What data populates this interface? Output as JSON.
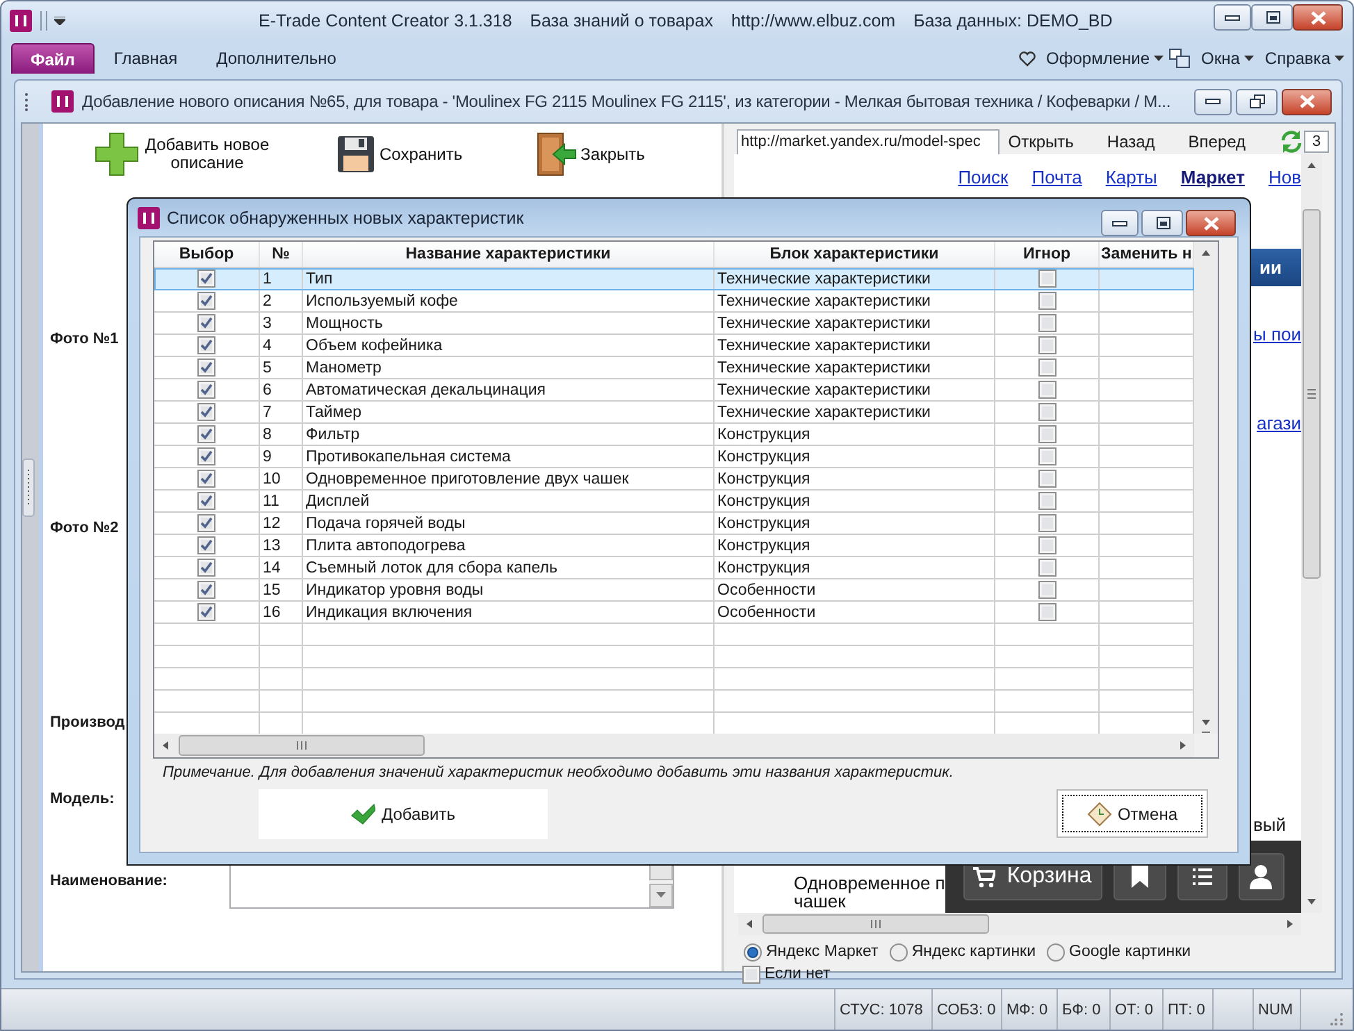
{
  "window": {
    "title_parts": [
      "E-Trade Content Creator 3.1.318",
      "База знаний о товарах",
      "http://www.elbuz.com",
      "База данных: DEMO_BD"
    ]
  },
  "ribbon": {
    "tabs": [
      {
        "label": "Файл",
        "selected": true
      },
      {
        "label": "Главная",
        "selected": false
      },
      {
        "label": "Дополнительно",
        "selected": false
      }
    ],
    "menus": [
      {
        "label": "Оформление",
        "kind": "theme"
      },
      {
        "label": "Окна",
        "kind": "windows"
      },
      {
        "label": "Справка",
        "kind": "help"
      }
    ]
  },
  "document": {
    "title": "Добавление нового описания №65, для товара - 'Moulinex FG 2115 Moulinex FG 2115', из категории - Мелкая бытовая техника / Кофеварки / М...",
    "toolbar": [
      {
        "label": "Добавить новое описание",
        "kind": "add"
      },
      {
        "label": "Сохранить",
        "kind": "save"
      },
      {
        "label": "Закрыть",
        "kind": "close"
      }
    ],
    "form": [
      {
        "label": "Фото №1",
        "kind": "label"
      },
      {
        "label": "Фото №2",
        "kind": "label"
      },
      {
        "label": "Производ",
        "kind": "label"
      },
      {
        "label": "Модель:",
        "kind": "label"
      },
      {
        "label": "Наименование:",
        "kind": "text"
      }
    ]
  },
  "browser": {
    "url": "http://market.yandex.ru/model-spec",
    "buttons": [
      "Открыть",
      "Назад",
      "Вперед"
    ],
    "tab_count": "3",
    "links": [
      {
        "label": "Поиск",
        "selected": false
      },
      {
        "label": "Почта",
        "selected": false
      },
      {
        "label": "Карты",
        "selected": false
      },
      {
        "label": "Маркет",
        "selected": true
      },
      {
        "label": "Нов",
        "selected": false
      }
    ],
    "page_texts": [
      {
        "text": "ии",
        "kind": "heading"
      },
      {
        "text": "ы пои",
        "kind": "link"
      },
      {
        "text": "агази",
        "kind": "link"
      },
      {
        "text": "вый",
        "kind": "text"
      }
    ],
    "product_lines": [
      "Одновременное п",
      "чашек"
    ],
    "cart_button": "Корзина",
    "sources": [
      {
        "label": "Яндекс Маркет",
        "selected": true
      },
      {
        "label": "Яндекс картинки",
        "selected": false
      },
      {
        "label": "Google картинки",
        "selected": false
      }
    ],
    "if_none": {
      "label": "Если нет",
      "checked": false
    }
  },
  "dialog": {
    "title": "Список обнаруженных новых характеристик",
    "columns": [
      "Выбор",
      "№",
      "Название характеристики",
      "Блок характеристики",
      "Игнор",
      "Заменить н"
    ],
    "rows": [
      {
        "number": "1",
        "name": "Тип",
        "block": "Технические характеристики",
        "chosen": true,
        "ignored": false,
        "selected": true
      },
      {
        "number": "2",
        "name": "Используемый кофе",
        "block": "Технические характеристики",
        "chosen": true,
        "ignored": false,
        "selected": false
      },
      {
        "number": "3",
        "name": "Мощность",
        "block": "Технические характеристики",
        "chosen": true,
        "ignored": false,
        "selected": false
      },
      {
        "number": "4",
        "name": "Объем кофейника",
        "block": "Технические характеристики",
        "chosen": true,
        "ignored": false,
        "selected": false
      },
      {
        "number": "5",
        "name": "Манометр",
        "block": "Технические характеристики",
        "chosen": true,
        "ignored": false,
        "selected": false
      },
      {
        "number": "6",
        "name": "Автоматическая декальцинация",
        "block": "Технические характеристики",
        "chosen": true,
        "ignored": false,
        "selected": false
      },
      {
        "number": "7",
        "name": "Таймер",
        "block": "Технические характеристики",
        "chosen": true,
        "ignored": false,
        "selected": false
      },
      {
        "number": "8",
        "name": "Фильтр",
        "block": "Конструкция",
        "chosen": true,
        "ignored": false,
        "selected": false
      },
      {
        "number": "9",
        "name": "Противокапельная система",
        "block": "Конструкция",
        "chosen": true,
        "ignored": false,
        "selected": false
      },
      {
        "number": "10",
        "name": "Одновременное приготовление двух чашек",
        "block": "Конструкция",
        "chosen": true,
        "ignored": false,
        "selected": false
      },
      {
        "number": "11",
        "name": "Дисплей",
        "block": "Конструкция",
        "chosen": true,
        "ignored": false,
        "selected": false
      },
      {
        "number": "12",
        "name": "Подача горячей воды",
        "block": "Конструкция",
        "chosen": true,
        "ignored": false,
        "selected": false
      },
      {
        "number": "13",
        "name": "Плита автоподогрева",
        "block": "Конструкция",
        "chosen": true,
        "ignored": false,
        "selected": false
      },
      {
        "number": "14",
        "name": "Съемный лоток для сбора капель",
        "block": "Конструкция",
        "chosen": true,
        "ignored": false,
        "selected": false
      },
      {
        "number": "15",
        "name": "Индикатор уровня воды",
        "block": "Особенности",
        "chosen": true,
        "ignored": false,
        "selected": false
      },
      {
        "number": "16",
        "name": "Индикация включения",
        "block": "Особенности",
        "chosen": true,
        "ignored": false,
        "selected": false
      }
    ],
    "note": "Примечание. Для добавления значений характеристик необходимо добавить эти названия характеристик.",
    "buttons": [
      {
        "label": "Добавить",
        "kind": "add",
        "focused": false
      },
      {
        "label": "Отмена",
        "kind": "cancel",
        "focused": true
      }
    ]
  },
  "status_bar": {
    "counters": [
      "СТУС: 1078",
      "СОБЗ: 0",
      "МФ: 0",
      "БФ: 0",
      "ОТ: 0",
      "ПТ: 0"
    ],
    "keys": [
      "NUM"
    ]
  }
}
